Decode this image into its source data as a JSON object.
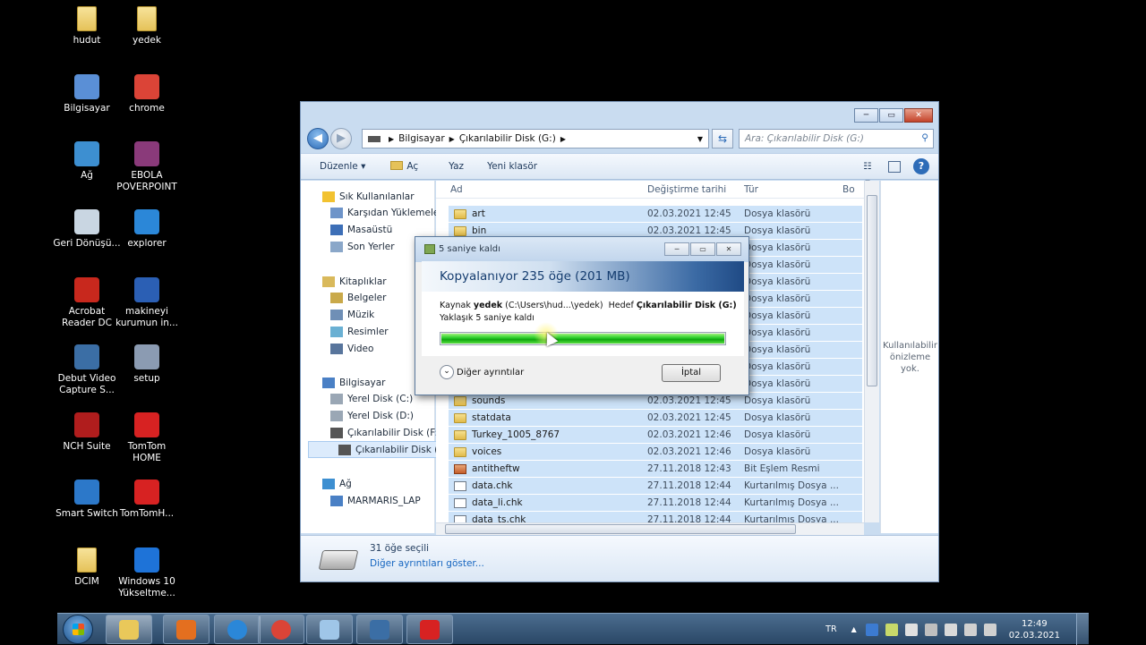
{
  "desktop": {
    "icons": [
      {
        "label": "hudut",
        "icon": "folder-icon"
      },
      {
        "label": "yedek",
        "icon": "folder-icon"
      },
      {
        "label": "Bilgisayar",
        "icon": "computer-icon"
      },
      {
        "label": "chrome",
        "icon": "chrome-icon"
      },
      {
        "label": "Ağ",
        "icon": "network-icon"
      },
      {
        "label": "EBOLA POVERPOINT",
        "icon": "winrar-icon"
      },
      {
        "label": "Geri Dönüşü...",
        "icon": "recycle-bin-icon"
      },
      {
        "label": "explorer",
        "icon": "ie-icon"
      },
      {
        "label": "Acrobat Reader DC",
        "icon": "acrobat-icon"
      },
      {
        "label": "makineyi kurumun in...",
        "icon": "word-doc-icon"
      },
      {
        "label": "Debut Video Capture S...",
        "icon": "debut-icon"
      },
      {
        "label": "setup",
        "icon": "setup-icon"
      },
      {
        "label": "NCH Suite",
        "icon": "nch-icon"
      },
      {
        "label": "TomTom HOME",
        "icon": "tomtom-icon"
      },
      {
        "label": "Smart Switch",
        "icon": "smart-switch-icon"
      },
      {
        "label": "TomTomH...",
        "icon": "tomtom-icon"
      },
      {
        "label": "DCIM",
        "icon": "folder-icon"
      },
      {
        "label": "Windows 10 Yükseltme...",
        "icon": "windows10-icon"
      }
    ]
  },
  "explorer": {
    "breadcrumb": [
      "Bilgisayar",
      "Çıkarılabilir Disk (G:)"
    ],
    "search_placeholder": "Ara: Çıkarılabilir Disk (G:)",
    "toolbar": {
      "organize": "Düzenle",
      "open": "Aç",
      "burn": "Yaz",
      "new_folder": "Yeni klasör"
    },
    "nav": [
      {
        "label": "Sık Kullanılanlar",
        "level": 0
      },
      {
        "label": "Karşıdan Yüklemeler",
        "level": 1
      },
      {
        "label": "Masaüstü",
        "level": 1
      },
      {
        "label": "Son Yerler",
        "level": 1
      },
      {
        "label": "Kitaplıklar",
        "level": 0
      },
      {
        "label": "Belgeler",
        "level": 1
      },
      {
        "label": "Müzik",
        "level": 1
      },
      {
        "label": "Resimler",
        "level": 1
      },
      {
        "label": "Video",
        "level": 1
      },
      {
        "label": "Bilgisayar",
        "level": 0
      },
      {
        "label": "Yerel Disk (C:)",
        "level": 1
      },
      {
        "label": "Yerel Disk (D:)",
        "level": 1
      },
      {
        "label": "Çıkarılabilir Disk (F:)",
        "level": 1
      },
      {
        "label": "Çıkarılabilir Disk (G:)",
        "level": 1,
        "selected": true
      },
      {
        "label": "Ağ",
        "level": 0
      },
      {
        "label": "MARMARIS_LAP",
        "level": 1
      }
    ],
    "columns": {
      "name": "Ad",
      "date": "Değiştirme tarihi",
      "type": "Tür",
      "size": "Bo"
    },
    "files": [
      {
        "name": "art",
        "date": "02.03.2021 12:45",
        "type": "Dosya klasörü",
        "kind": "folder"
      },
      {
        "name": "bin",
        "date": "02.03.2021 12:45",
        "type": "Dosya klasörü",
        "kind": "folder"
      },
      {
        "name": "",
        "date": "",
        "type": "Dosya klasörü",
        "kind": "folder"
      },
      {
        "name": "",
        "date": "",
        "type": "Dosya klasörü",
        "kind": "folder"
      },
      {
        "name": "",
        "date": "",
        "type": "Dosya klasörü",
        "kind": "folder"
      },
      {
        "name": "",
        "date": "",
        "type": "Dosya klasörü",
        "kind": "folder"
      },
      {
        "name": "",
        "date": "",
        "type": "Dosya klasörü",
        "kind": "folder"
      },
      {
        "name": "",
        "date": "",
        "type": "Dosya klasörü",
        "kind": "folder"
      },
      {
        "name": "",
        "date": "",
        "type": "Dosya klasörü",
        "kind": "folder"
      },
      {
        "name": "",
        "date": "",
        "type": "Dosya klasörü",
        "kind": "folder"
      },
      {
        "name": "",
        "date": "",
        "type": "Dosya klasörü",
        "kind": "folder"
      },
      {
        "name": "sounds",
        "date": "02.03.2021 12:45",
        "type": "Dosya klasörü",
        "kind": "folder"
      },
      {
        "name": "statdata",
        "date": "02.03.2021 12:45",
        "type": "Dosya klasörü",
        "kind": "folder"
      },
      {
        "name": "Turkey_1005_8767",
        "date": "02.03.2021 12:46",
        "type": "Dosya klasörü",
        "kind": "folder"
      },
      {
        "name": "voices",
        "date": "02.03.2021 12:46",
        "type": "Dosya klasörü",
        "kind": "folder"
      },
      {
        "name": "antitheftw",
        "date": "27.11.2018 12:43",
        "type": "Bit Eşlem Resmi",
        "kind": "img"
      },
      {
        "name": "data.chk",
        "date": "27.11.2018 12:44",
        "type": "Kurtarılmış Dosya ...",
        "kind": "doc"
      },
      {
        "name": "data_li.chk",
        "date": "27.11.2018 12:44",
        "type": "Kurtarılmış Dosya ...",
        "kind": "doc"
      },
      {
        "name": "data_ts.chk",
        "date": "27.11.2018 12:44",
        "type": "Kurtarılmış Dosya ...",
        "kind": "doc"
      }
    ],
    "preview_text": "Kullanılabilir önizleme yok.",
    "details": {
      "count": "31 öğe seçili",
      "more": "Diğer ayrıntıları göster..."
    }
  },
  "copy_dialog": {
    "title": "5 saniye kaldı",
    "header": "Kopyalanıyor 235 öğe (201 MB)",
    "source_prefix": "Kaynak",
    "source_name": "yedek",
    "source_path": "(C:\\Users\\hud...\\yedek)",
    "dest_prefix": "Hedef",
    "dest_name": "Çıkarılabilir Disk (G:)",
    "remaining": "Yaklaşık 5 saniye kaldı",
    "progress": 1.0,
    "more_details": "Diğer ayrıntılar",
    "cancel": "İptal"
  },
  "taskbar": {
    "apps": [
      "explorer-icon",
      "media-player-icon",
      "ie-icon",
      "chrome-icon",
      "notepad-icon",
      "debut-icon",
      "tomtom-icon"
    ],
    "language": "TR",
    "time": "12:49",
    "date": "02.03.2021"
  }
}
